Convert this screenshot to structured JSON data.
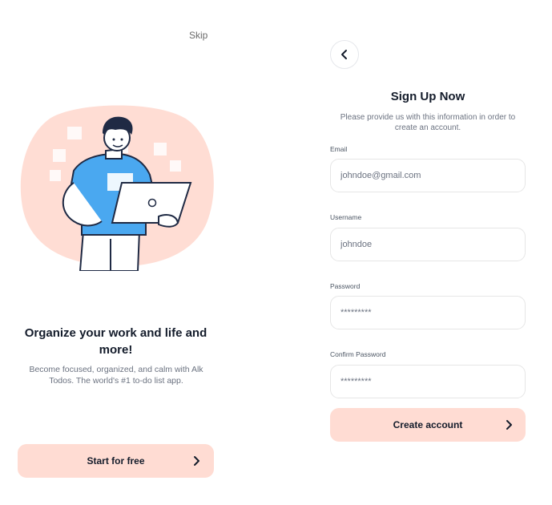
{
  "onboarding": {
    "skip_label": "Skip",
    "title": "Organize your work and life and more!",
    "subtitle": "Become focused, organized, and calm with Alk Todos. The world's #1 to-do list app.",
    "start_label": "Start for free"
  },
  "signup": {
    "title": "Sign Up Now",
    "subtitle": "Please provide us with this information in order to create an account.",
    "fields": [
      {
        "label": "Email",
        "value": "johndoe@gmail.com"
      },
      {
        "label": "Username",
        "value": "johndoe"
      },
      {
        "label": "Password",
        "value": "*********"
      },
      {
        "label": "Confirm Password",
        "value": "*********"
      }
    ],
    "create_label": "Create account"
  },
  "colors": {
    "accent": "#ffdcd3",
    "blob": "#ffddd4",
    "shirt": "#4aa8f0",
    "text_dark": "#141c2b",
    "text_muted": "#6b7280"
  },
  "icons": {
    "back": "chevron-left-icon",
    "next": "chevron-right-icon"
  }
}
